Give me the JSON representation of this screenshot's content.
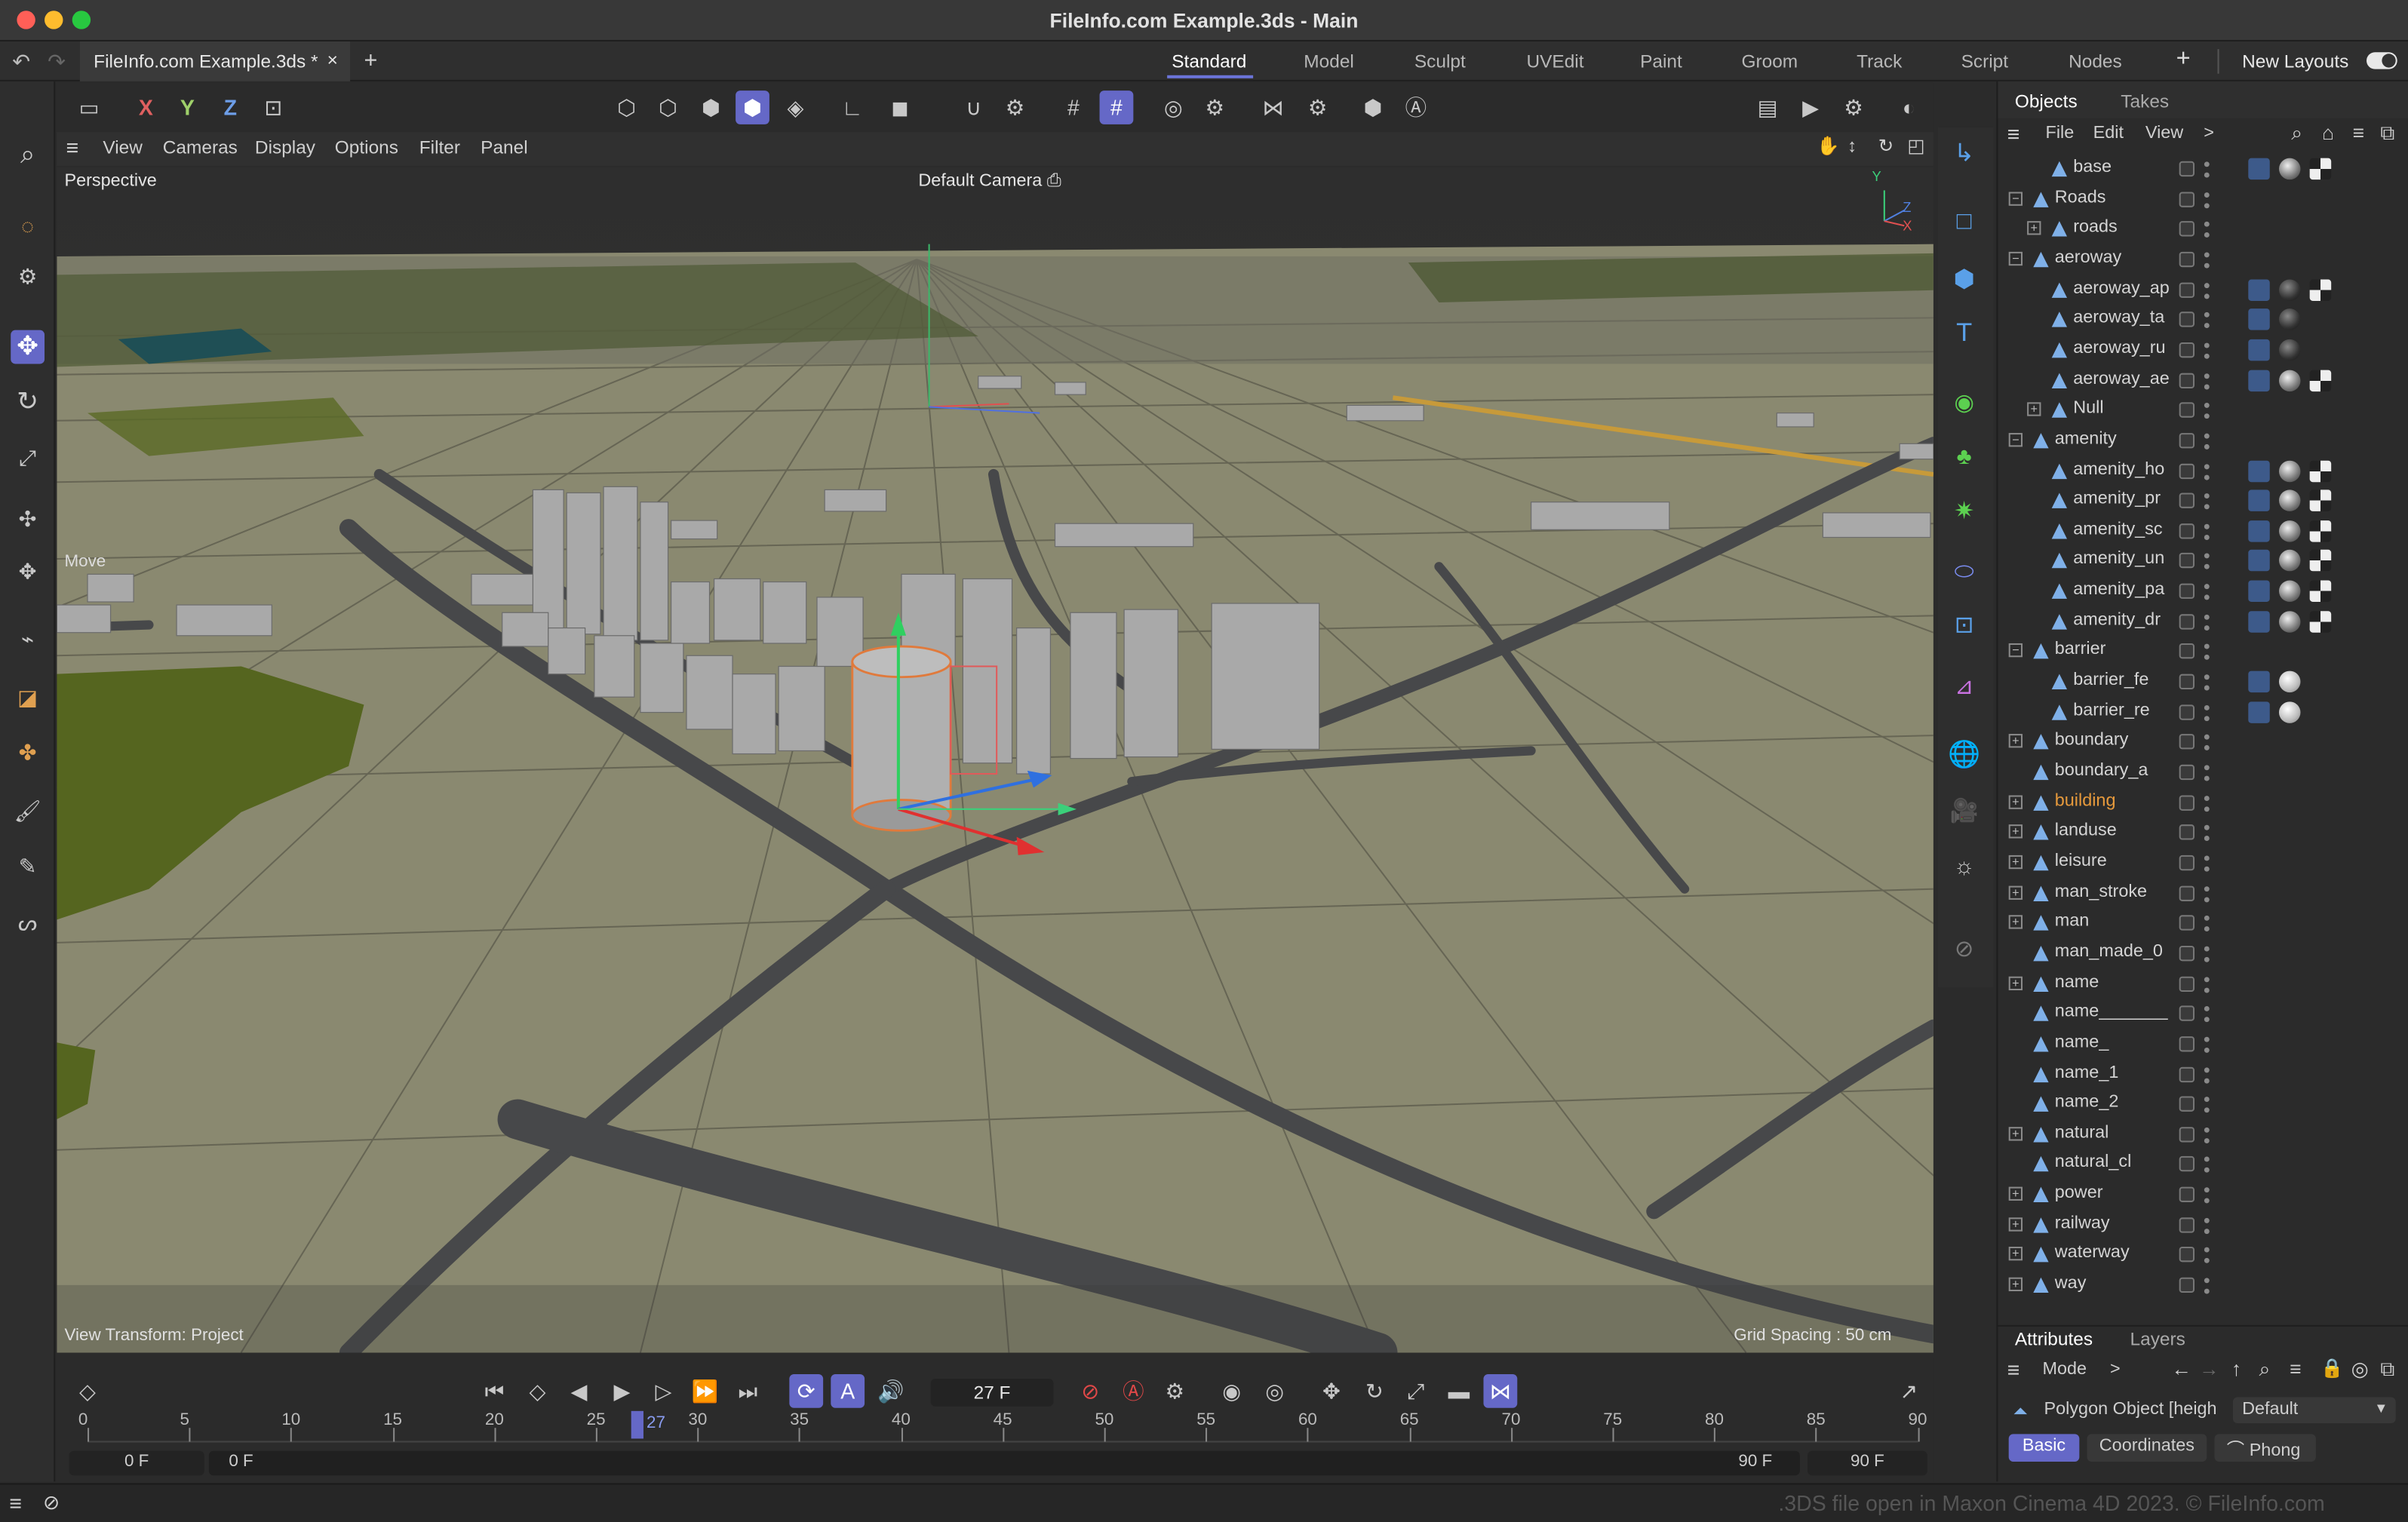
{
  "window": {
    "title": "FileInfo.com Example.3ds - Main"
  },
  "doc_tab": {
    "label": "FileInfo.com Example.3ds *",
    "close": "×",
    "add": "+"
  },
  "layouts": [
    "Standard",
    "Model",
    "Sculpt",
    "UVEdit",
    "Paint",
    "Groom",
    "Track",
    "Script",
    "Nodes"
  ],
  "layouts_add": "+",
  "new_layouts": "New Layouts",
  "axis_buttons": [
    "X",
    "Y",
    "Z"
  ],
  "viewport_menu": [
    "View",
    "Cameras",
    "Display",
    "Options",
    "Filter",
    "Panel"
  ],
  "viewport": {
    "name": "Perspective",
    "camera": "Default Camera",
    "tool_label": "Move",
    "view_transform": "View Transform: Project",
    "grid_spacing": "Grid Spacing : 50 cm",
    "axis_y": "Y",
    "axis_z": "Z",
    "axis_x": "X"
  },
  "objects_panel": {
    "tabs": [
      "Objects",
      "Takes"
    ],
    "menu": [
      "File",
      "Edit",
      "View"
    ],
    "more": ">",
    "rows": [
      {
        "name": "base",
        "indent": 1,
        "expander": "",
        "tags": [
          "mat-tag",
          "sphere-tag",
          "checker-tag"
        ]
      },
      {
        "name": "Roads",
        "indent": 0,
        "expander": "−",
        "tags": []
      },
      {
        "name": "roads",
        "indent": 1,
        "expander": "+",
        "tags": []
      },
      {
        "name": "aeroway",
        "indent": 0,
        "expander": "−",
        "tags": []
      },
      {
        "name": "aeroway_ap",
        "indent": 1,
        "expander": "",
        "tags": [
          "mat-tag",
          "dark-sphere-tag",
          "checker-tag"
        ]
      },
      {
        "name": "aeroway_ta",
        "indent": 1,
        "expander": "",
        "tags": [
          "mat-tag",
          "dark-sphere-tag"
        ]
      },
      {
        "name": "aeroway_ru",
        "indent": 1,
        "expander": "",
        "tags": [
          "mat-tag",
          "dark-sphere-tag"
        ]
      },
      {
        "name": "aeroway_ae",
        "indent": 1,
        "expander": "",
        "tags": [
          "mat-tag",
          "sphere-tag",
          "checker-tag"
        ]
      },
      {
        "name": "Null",
        "indent": 1,
        "expander": "+",
        "tags": []
      },
      {
        "name": "amenity",
        "indent": 0,
        "expander": "−",
        "tags": []
      },
      {
        "name": "amenity_ho",
        "indent": 1,
        "expander": "",
        "tags": [
          "mat-tag",
          "sphere-tag",
          "checker-tag"
        ]
      },
      {
        "name": "amenity_pr",
        "indent": 1,
        "expander": "",
        "tags": [
          "mat-tag",
          "sphere-tag",
          "checker-tag"
        ]
      },
      {
        "name": "amenity_sc",
        "indent": 1,
        "expander": "",
        "tags": [
          "mat-tag",
          "sphere-tag",
          "checker-tag"
        ]
      },
      {
        "name": "amenity_un",
        "indent": 1,
        "expander": "",
        "tags": [
          "mat-tag",
          "sphere-tag",
          "checker-tag"
        ]
      },
      {
        "name": "amenity_pa",
        "indent": 1,
        "expander": "",
        "tags": [
          "mat-tag",
          "sphere-tag",
          "checker-tag"
        ]
      },
      {
        "name": "amenity_dr",
        "indent": 1,
        "expander": "",
        "tags": [
          "mat-tag",
          "sphere-tag",
          "checker-tag"
        ]
      },
      {
        "name": "barrier",
        "indent": 0,
        "expander": "−",
        "tags": []
      },
      {
        "name": "barrier_fe",
        "indent": 1,
        "expander": "",
        "tags": [
          "mat-tag",
          "white-sphere-tag"
        ]
      },
      {
        "name": "barrier_re",
        "indent": 1,
        "expander": "",
        "tags": [
          "mat-tag",
          "white-sphere-tag"
        ]
      },
      {
        "name": "boundary",
        "indent": 0,
        "expander": "+",
        "tags": []
      },
      {
        "name": "boundary_a",
        "indent": 0,
        "expander": "",
        "tags": []
      },
      {
        "name": "building",
        "indent": 0,
        "expander": "+",
        "tags": [],
        "selected": true
      },
      {
        "name": "landuse",
        "indent": 0,
        "expander": "+",
        "tags": []
      },
      {
        "name": "leisure",
        "indent": 0,
        "expander": "+",
        "tags": []
      },
      {
        "name": "man_stroke",
        "indent": 0,
        "expander": "+",
        "tags": []
      },
      {
        "name": "man",
        "indent": 0,
        "expander": "+",
        "tags": []
      },
      {
        "name": "man_made_0",
        "indent": 0,
        "expander": "",
        "tags": []
      },
      {
        "name": "name",
        "indent": 0,
        "expander": "+",
        "tags": []
      },
      {
        "name": "name_______",
        "indent": 0,
        "expander": "",
        "tags": []
      },
      {
        "name": "name_",
        "indent": 0,
        "expander": "",
        "tags": []
      },
      {
        "name": "name_1",
        "indent": 0,
        "expander": "",
        "tags": []
      },
      {
        "name": "name_2",
        "indent": 0,
        "expander": "",
        "tags": []
      },
      {
        "name": "natural",
        "indent": 0,
        "expander": "+",
        "tags": []
      },
      {
        "name": "natural_cl",
        "indent": 0,
        "expander": "",
        "tags": []
      },
      {
        "name": "power",
        "indent": 0,
        "expander": "+",
        "tags": []
      },
      {
        "name": "railway",
        "indent": 0,
        "expander": "+",
        "tags": []
      },
      {
        "name": "waterway",
        "indent": 0,
        "expander": "+",
        "tags": []
      },
      {
        "name": "way",
        "indent": 0,
        "expander": "+",
        "tags": []
      }
    ]
  },
  "attributes_panel": {
    "tabs": [
      "Attributes",
      "Layers"
    ],
    "mode": "Mode",
    "more": ">",
    "object_label": "Polygon Object [heigh",
    "layer_select": "Default",
    "subtabs": [
      "Basic",
      "Coordinates",
      "Phong"
    ]
  },
  "timeline": {
    "current_frame": "27 F",
    "ruler": [
      "0",
      "5",
      "10",
      "15",
      "20",
      "25",
      "30",
      "35",
      "40",
      "45",
      "50",
      "55",
      "60",
      "65",
      "70",
      "75",
      "80",
      "85",
      "90"
    ],
    "playhead": "27",
    "start": "0 F",
    "range_start": "0 F",
    "range_end": "90 F",
    "end": "90 F"
  },
  "status_bar": {
    "credit": ".3DS file open in Maxon Cinema 4D 2023. © FileInfo.com"
  },
  "colors": {
    "accent": "#6568c7",
    "selected_object": "#e79a3c",
    "ground": "#8b8a70",
    "grass": "#55651f",
    "road": "#47484a"
  }
}
